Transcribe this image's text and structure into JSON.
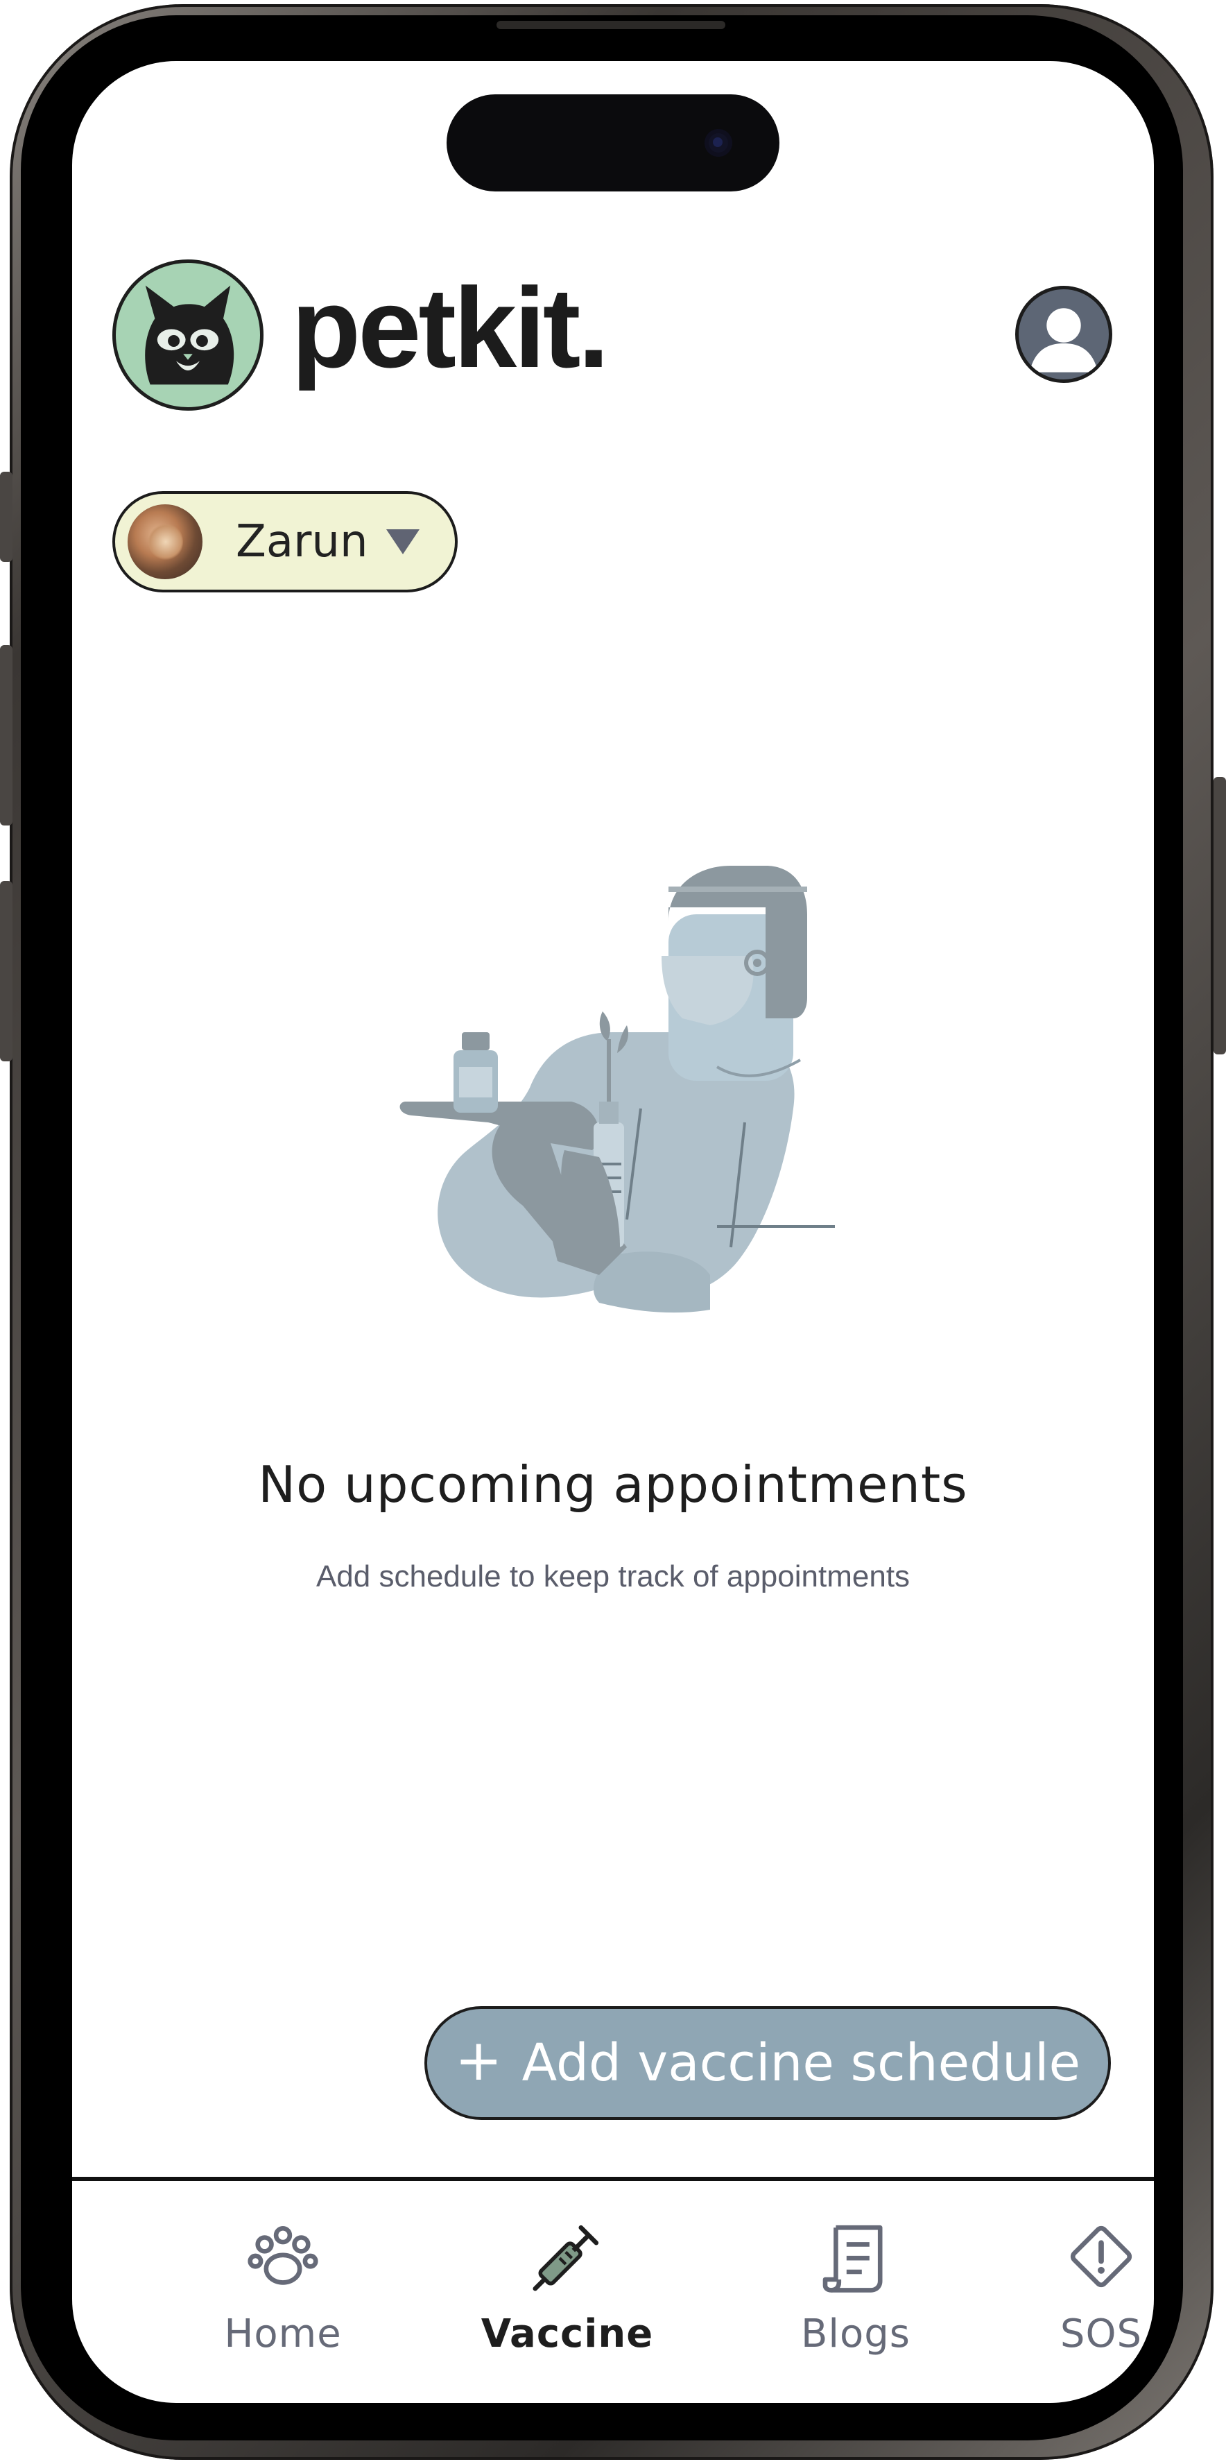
{
  "app": {
    "brand_name": "petkit."
  },
  "header": {
    "avatar_icon": "user-avatar-icon"
  },
  "pet_selector": {
    "selected_pet": "Zarun",
    "caret_icon": "caret-down-icon"
  },
  "empty_state": {
    "illustration": "vet-with-vaccine-illustration",
    "title": "No upcoming appointments",
    "subtitle": "Add schedule to keep track of appointments"
  },
  "actions": {
    "add_plus": "+",
    "add_label": "Add vaccine schedule"
  },
  "bottom_nav": {
    "items": [
      {
        "label": "Home",
        "icon": "paw-icon",
        "active": false
      },
      {
        "label": "Vaccine",
        "icon": "syringe-icon",
        "active": true
      },
      {
        "label": "Blogs",
        "icon": "document-icon",
        "active": false
      },
      {
        "label": "SOS",
        "icon": "warning-icon",
        "active": false
      }
    ]
  },
  "colors": {
    "logo_green": "#a7d3b4",
    "pet_chip_bg": "#f1f3d4",
    "button_blue_gray": "#8fa6b4",
    "illustration_fill": "#b0c1cb",
    "text_dark": "#1e1e1e",
    "text_muted": "#5a5d6b"
  }
}
